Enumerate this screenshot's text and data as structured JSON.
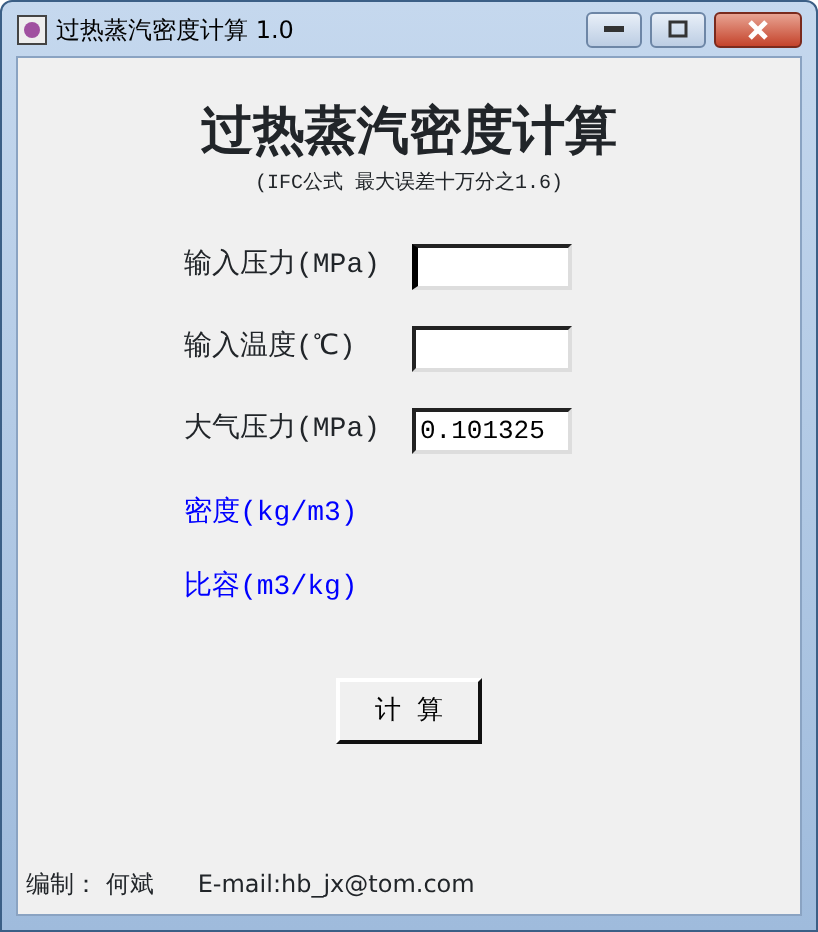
{
  "window": {
    "title": "过热蒸汽密度计算 1.0"
  },
  "heading": "过热蒸汽密度计算",
  "subtitle": "(IFC公式  最大误差十万分之1.6)",
  "inputs": [
    {
      "label": "输入压力(MPa)",
      "focused": true
    },
    {
      "label": "输入温度(℃)",
      "focused": false
    },
    {
      "label": "大气压力(MPa)",
      "value": "0.101325",
      "focused": false
    }
  ],
  "results": [
    "密度(kg/m3)",
    "比容(m3/kg)"
  ],
  "button": "计  算",
  "footer": {
    "author": "编制： 何斌",
    "email": "E-mail:hb_jx@tom.com"
  }
}
